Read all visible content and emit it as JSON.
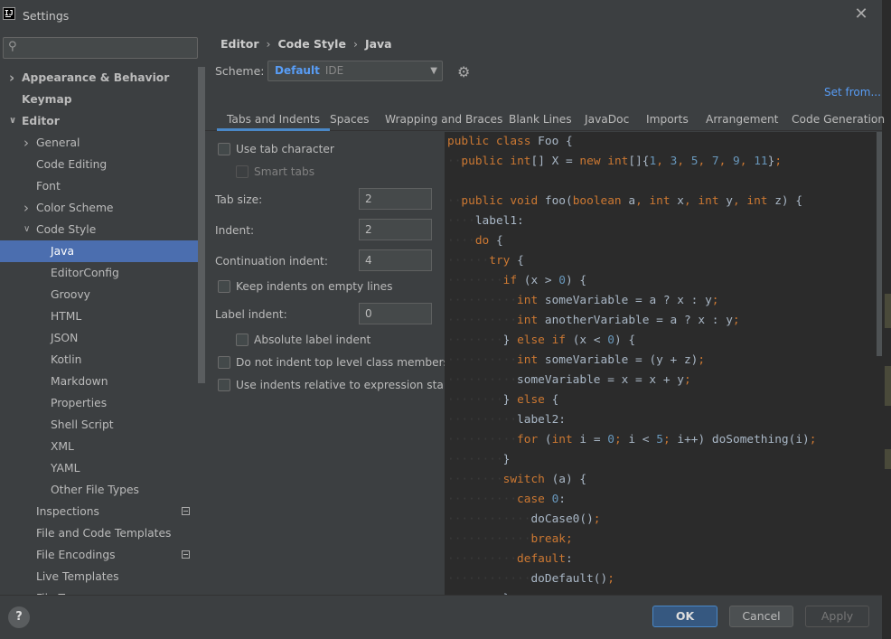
{
  "window": {
    "title": "Settings",
    "app_icon": "IJ"
  },
  "search": {
    "placeholder": ""
  },
  "tree": [
    {
      "label": "Appearance & Behavior",
      "bold": true,
      "level": 0,
      "arrow": "right"
    },
    {
      "label": "Keymap",
      "bold": true,
      "level": 0,
      "arrow": ""
    },
    {
      "label": "Editor",
      "bold": true,
      "level": 0,
      "arrow": "down"
    },
    {
      "label": "General",
      "level": 1,
      "arrow": "right"
    },
    {
      "label": "Code Editing",
      "level": 1,
      "arrow": ""
    },
    {
      "label": "Font",
      "level": 1,
      "arrow": ""
    },
    {
      "label": "Color Scheme",
      "level": 1,
      "arrow": "right"
    },
    {
      "label": "Code Style",
      "level": 1,
      "arrow": "down"
    },
    {
      "label": "Java",
      "level": 2,
      "arrow": "",
      "selected": true
    },
    {
      "label": "EditorConfig",
      "level": 2,
      "arrow": ""
    },
    {
      "label": "Groovy",
      "level": 2,
      "arrow": ""
    },
    {
      "label": "HTML",
      "level": 2,
      "arrow": ""
    },
    {
      "label": "JSON",
      "level": 2,
      "arrow": ""
    },
    {
      "label": "Kotlin",
      "level": 2,
      "arrow": ""
    },
    {
      "label": "Markdown",
      "level": 2,
      "arrow": ""
    },
    {
      "label": "Properties",
      "level": 2,
      "arrow": ""
    },
    {
      "label": "Shell Script",
      "level": 2,
      "arrow": ""
    },
    {
      "label": "XML",
      "level": 2,
      "arrow": ""
    },
    {
      "label": "YAML",
      "level": 2,
      "arrow": ""
    },
    {
      "label": "Other File Types",
      "level": 2,
      "arrow": ""
    },
    {
      "label": "Inspections",
      "level": 1,
      "arrow": "",
      "icon": true
    },
    {
      "label": "File and Code Templates",
      "level": 1,
      "arrow": ""
    },
    {
      "label": "File Encodings",
      "level": 1,
      "arrow": "",
      "icon": true
    },
    {
      "label": "Live Templates",
      "level": 1,
      "arrow": ""
    },
    {
      "label": "File Types",
      "level": 1,
      "arrow": ""
    }
  ],
  "breadcrumb": [
    "Editor",
    "Code Style",
    "Java"
  ],
  "scheme": {
    "label": "Scheme:",
    "value": "Default",
    "kind": "IDE"
  },
  "set_from": "Set from...",
  "tabs": [
    "Tabs and Indents",
    "Spaces",
    "Wrapping and Braces",
    "Blank Lines",
    "JavaDoc",
    "Imports",
    "Arrangement",
    "Code Generation"
  ],
  "options": {
    "use_tab": "Use tab character",
    "smart_tabs": "Smart tabs",
    "tab_size_label": "Tab size:",
    "tab_size": "2",
    "indent_label": "Indent:",
    "indent": "2",
    "cont_indent_label": "Continuation indent:",
    "cont_indent": "4",
    "keep_indents": "Keep indents on empty lines",
    "label_indent_label": "Label indent:",
    "label_indent": "0",
    "absolute_label": "Absolute label indent",
    "no_indent_top": "Do not indent top level class members",
    "relative_indent": "Use indents relative to expression start"
  },
  "code": [
    [
      [
        "kw",
        "public class "
      ],
      [
        "plain",
        "Foo {"
      ]
    ],
    [
      [
        "gd",
        "··"
      ],
      [
        "kw",
        "public "
      ],
      [
        "kw",
        "int"
      ],
      [
        "plain",
        "[] X = "
      ],
      [
        "kw",
        "new int"
      ],
      [
        "plain",
        "[]{"
      ],
      [
        "num",
        "1"
      ],
      [
        "kw",
        ", "
      ],
      [
        "num",
        "3"
      ],
      [
        "kw",
        ", "
      ],
      [
        "num",
        "5"
      ],
      [
        "kw",
        ", "
      ],
      [
        "num",
        "7"
      ],
      [
        "kw",
        ", "
      ],
      [
        "num",
        "9"
      ],
      [
        "kw",
        ", "
      ],
      [
        "num",
        "11"
      ],
      [
        "plain",
        "}"
      ],
      [
        "kw",
        ";"
      ]
    ],
    [
      [
        "gd",
        ""
      ]
    ],
    [
      [
        "gd",
        "··"
      ],
      [
        "kw",
        "public void "
      ],
      [
        "plain",
        "foo("
      ],
      [
        "kw",
        "boolean "
      ],
      [
        "plain",
        "a"
      ],
      [
        "kw",
        ", int "
      ],
      [
        "plain",
        "x"
      ],
      [
        "kw",
        ", int "
      ],
      [
        "plain",
        "y"
      ],
      [
        "kw",
        ", int "
      ],
      [
        "plain",
        "z) {"
      ]
    ],
    [
      [
        "gd",
        "····"
      ],
      [
        "plain",
        "label1:"
      ]
    ],
    [
      [
        "gd",
        "····"
      ],
      [
        "kw",
        "do "
      ],
      [
        "plain",
        "{"
      ]
    ],
    [
      [
        "gd",
        "······"
      ],
      [
        "kw",
        "try "
      ],
      [
        "plain",
        "{"
      ]
    ],
    [
      [
        "gd",
        "········"
      ],
      [
        "kw",
        "if "
      ],
      [
        "plain",
        "(x > "
      ],
      [
        "num",
        "0"
      ],
      [
        "plain",
        ") {"
      ]
    ],
    [
      [
        "gd",
        "··········"
      ],
      [
        "kw",
        "int "
      ],
      [
        "plain",
        "someVariable = a ? x : y"
      ],
      [
        "kw",
        ";"
      ]
    ],
    [
      [
        "gd",
        "··········"
      ],
      [
        "kw",
        "int "
      ],
      [
        "plain",
        "anotherVariable = a ? x : y"
      ],
      [
        "kw",
        ";"
      ]
    ],
    [
      [
        "gd",
        "········"
      ],
      [
        "plain",
        "} "
      ],
      [
        "kw",
        "else if "
      ],
      [
        "plain",
        "(x < "
      ],
      [
        "num",
        "0"
      ],
      [
        "plain",
        ") {"
      ]
    ],
    [
      [
        "gd",
        "··········"
      ],
      [
        "kw",
        "int "
      ],
      [
        "plain",
        "someVariable = (y + z)"
      ],
      [
        "kw",
        ";"
      ]
    ],
    [
      [
        "gd",
        "··········"
      ],
      [
        "plain",
        "someVariable = x = x + y"
      ],
      [
        "kw",
        ";"
      ]
    ],
    [
      [
        "gd",
        "········"
      ],
      [
        "plain",
        "} "
      ],
      [
        "kw",
        "else "
      ],
      [
        "plain",
        "{"
      ]
    ],
    [
      [
        "gd",
        "··········"
      ],
      [
        "plain",
        "label2:"
      ]
    ],
    [
      [
        "gd",
        "··········"
      ],
      [
        "kw",
        "for "
      ],
      [
        "plain",
        "("
      ],
      [
        "kw",
        "int "
      ],
      [
        "plain",
        "i = "
      ],
      [
        "num",
        "0"
      ],
      [
        "kw",
        "; "
      ],
      [
        "plain",
        "i < "
      ],
      [
        "num",
        "5"
      ],
      [
        "kw",
        "; "
      ],
      [
        "plain",
        "i++) doSomething(i)"
      ],
      [
        "kw",
        ";"
      ]
    ],
    [
      [
        "gd",
        "········"
      ],
      [
        "plain",
        "}"
      ]
    ],
    [
      [
        "gd",
        "········"
      ],
      [
        "kw",
        "switch "
      ],
      [
        "plain",
        "(a) {"
      ]
    ],
    [
      [
        "gd",
        "··········"
      ],
      [
        "kw",
        "case "
      ],
      [
        "num",
        "0"
      ],
      [
        "plain",
        ":"
      ]
    ],
    [
      [
        "gd",
        "············"
      ],
      [
        "plain",
        "doCase0()"
      ],
      [
        "kw",
        ";"
      ]
    ],
    [
      [
        "gd",
        "············"
      ],
      [
        "kw",
        "break;"
      ]
    ],
    [
      [
        "gd",
        "··········"
      ],
      [
        "kw",
        "default"
      ],
      [
        "plain",
        ":"
      ]
    ],
    [
      [
        "gd",
        "············"
      ],
      [
        "plain",
        "doDefault()"
      ],
      [
        "kw",
        ";"
      ]
    ],
    [
      [
        "gd",
        "········"
      ],
      [
        "plain",
        "}"
      ]
    ]
  ],
  "buttons": {
    "help": "?",
    "ok": "OK",
    "cancel": "Cancel",
    "apply": "Apply"
  }
}
